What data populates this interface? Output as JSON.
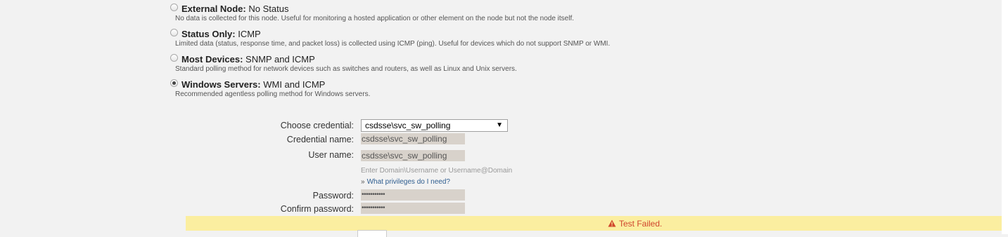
{
  "polling_options": [
    {
      "title": "External Node:",
      "value": "No Status",
      "description": "No data is collected for this node. Useful for monitoring a hosted application or other element on the node but not the node itself.",
      "selected": false
    },
    {
      "title": "Status Only:",
      "value": "ICMP",
      "description": "Limited data (status, response time, and packet loss) is collected using ICMP (ping). Useful for devices which do not support SNMP or WMI.",
      "selected": false
    },
    {
      "title": "Most Devices:",
      "value": "SNMP and ICMP",
      "description": "Standard polling method for network devices such as switches and routers, as well as Linux and Unix servers.",
      "selected": false
    },
    {
      "title": "Windows Servers:",
      "value": "WMI and ICMP",
      "description": "Recommended agentless polling method for Windows servers.",
      "selected": true
    }
  ],
  "credential_form": {
    "choose_label": "Choose credential:",
    "choose_value": "csdsse\\svc_sw_polling",
    "dropdown_arrow": "▼",
    "name_label": "Credential name:",
    "name_value": "csdsse\\svc_sw_polling",
    "user_label": "User name:",
    "user_value": "csdsse\\svc_sw_polling",
    "user_hint": "Enter Domain\\Username or Username@Domain",
    "privileges_link_prefix": "»",
    "privileges_link": "What privileges do I need?",
    "password_label": "Password:",
    "password_value": "•••••••••••",
    "confirm_label": "Confirm password:",
    "confirm_value": "•••••••••••"
  },
  "alert": {
    "text": "Test Failed.",
    "icon": "warning-triangle-icon",
    "text_color": "#d0462d",
    "background": "#fbeea0"
  }
}
